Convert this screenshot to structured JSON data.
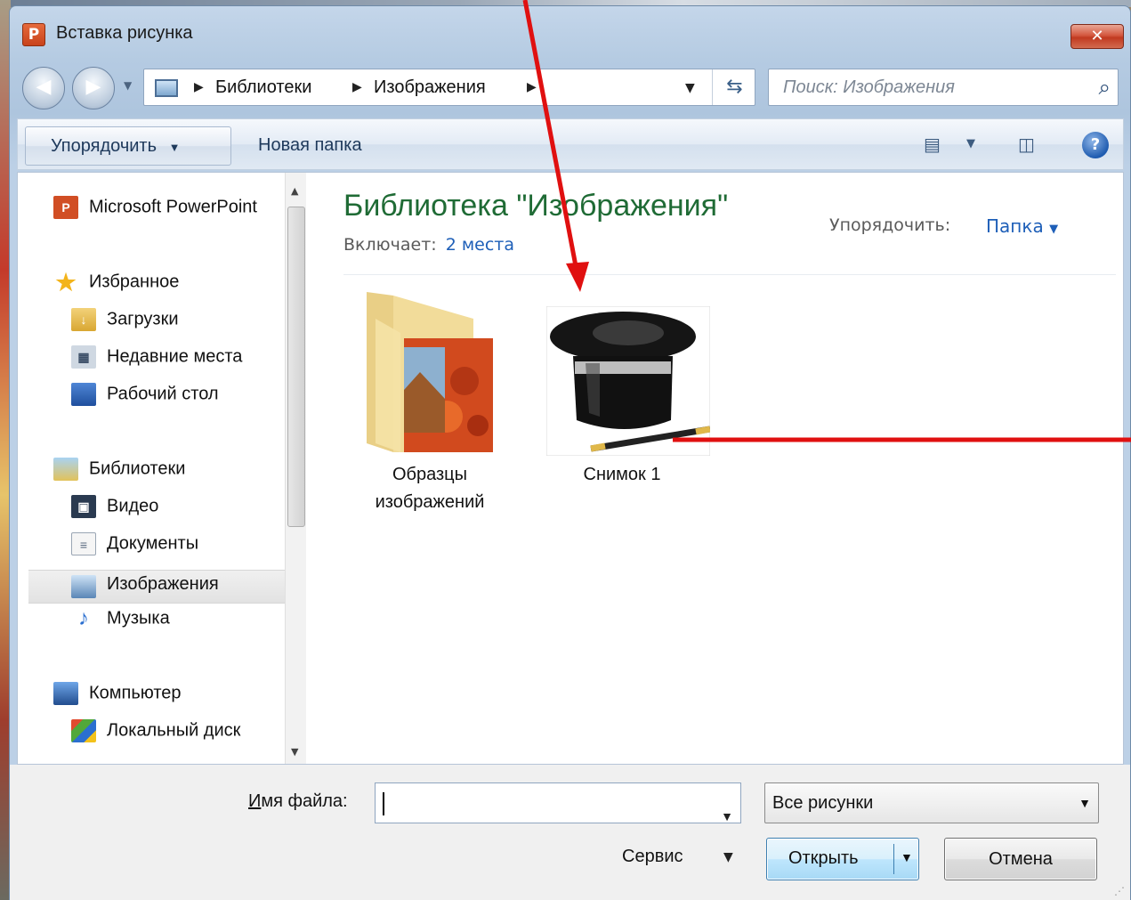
{
  "window": {
    "title": "Вставка рисунка",
    "app_icon_letter": "P",
    "close_label": "✕"
  },
  "address_bar": {
    "crumbs": [
      "Библиотеки",
      "Изображения"
    ],
    "search_placeholder": "Поиск: Изображения"
  },
  "toolbar": {
    "organize_label": "Упорядочить",
    "new_folder_label": "Новая папка",
    "help_label": "?"
  },
  "nav_pane": {
    "items": [
      {
        "label": "Microsoft PowerPoint",
        "icon": "powerpoint-icon"
      },
      {
        "label": "Избранное",
        "icon": "star-icon"
      },
      {
        "label": "Загрузки",
        "icon": "downloads-icon"
      },
      {
        "label": "Недавние места",
        "icon": "recent-places-icon"
      },
      {
        "label": "Рабочий стол",
        "icon": "desktop-icon"
      },
      {
        "label": "Библиотеки",
        "icon": "libraries-icon"
      },
      {
        "label": "Видео",
        "icon": "video-icon"
      },
      {
        "label": "Документы",
        "icon": "documents-icon"
      },
      {
        "label": "Изображения",
        "icon": "pictures-icon",
        "selected": true
      },
      {
        "label": "Музыка",
        "icon": "music-icon"
      },
      {
        "label": "Компьютер",
        "icon": "computer-icon"
      },
      {
        "label": "Локальный диск",
        "icon": "local-disk-icon"
      }
    ]
  },
  "library": {
    "title": "Библиотека \"Изображения\"",
    "includes_label": "Включает:",
    "includes_link": "2 места",
    "arrange_label": "Упорядочить:",
    "arrange_value": "Папка"
  },
  "files": [
    {
      "label": "Образцы изображений",
      "icon": "sample-pictures-folder-icon"
    },
    {
      "label": "Снимок 1",
      "icon": "magic-hat-image-icon"
    }
  ],
  "bottom": {
    "filename_label_first": "И",
    "filename_label_rest": "мя файла:",
    "filename_value": "",
    "file_type": "Все рисунки",
    "tools_label": "Сервис",
    "open_label": "Открыть",
    "cancel_label": "Отмена"
  },
  "colors": {
    "library_title": "#1f6b35",
    "link": "#1e5fb8",
    "annotation": "#e01010"
  }
}
